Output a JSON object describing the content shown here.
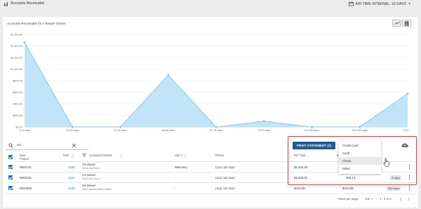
{
  "topbar": {
    "title": "Accounts Receivable",
    "interval_label": "A/R TIME INTERVAL: 15 DAYS"
  },
  "chart_data": {
    "type": "area",
    "title": "Accounts Receivable for 4 Repair Orders",
    "categories": [
      "0-15 days",
      "16-30 days",
      "31-45 days",
      "46-60 days",
      "61-75 days",
      "76-90 days",
      "91-105 days",
      "106-120 days",
      "120+"
    ],
    "values": [
      1460,
      0,
      0,
      895,
      0,
      100,
      0,
      0,
      575
    ],
    "yticks": [
      "$0.00",
      "$200.00",
      "$400.00",
      "$600.00",
      "$800.00",
      "$1,000.00",
      "$1,200.00",
      "$1,400.00",
      "$1,600.00"
    ],
    "ylim": [
      0,
      1600
    ],
    "grid": true,
    "color": "#6cbfef"
  },
  "search": {
    "value": "vin"
  },
  "print_button": {
    "label": "PRINT STATEMENT (1)"
  },
  "dropdown": {
    "items": [
      "Credit Card",
      "Cash",
      "Check",
      "Other"
    ]
  },
  "table": {
    "headers": {
      "date": "Date Posted",
      "ro": "RO#",
      "customer": "Customer/Vehicle",
      "unit": "Unit #",
      "phone": "Phone",
      "total": "RO Total",
      "balance": "B"
    },
    "rows": [
      {
        "date": "06/07/21",
        "ro": "1180",
        "name": "Vin Diesel",
        "vehicle": "2016 Kia Soul +",
        "unit": "Warranty",
        "phone": "(111) 111-1111",
        "total": "$1,622.60",
        "balance": "",
        "days": ""
      },
      {
        "date": "06/01/21",
        "ro": "1115",
        "name": "Vin Diesel",
        "vehicle": "2016 Kia Soul +",
        "unit": "-",
        "phone": "(111) 111-1111",
        "total": "$1,529.81",
        "balance": "$49.13",
        "days": "5 days"
      },
      {
        "date": "05/23/20",
        "ro": "1129",
        "name": "Vin Diesel",
        "vehicle": "2011 Nissan Altima Base",
        "unit": "-",
        "phone": "(111) 111-1111",
        "total": "$416.85",
        "balance": "$416.85",
        "days": "380 days"
      }
    ]
  },
  "footer": {
    "rows_per_page_label": "Rows per page",
    "rows_per_page_value": "100",
    "range": "1 - 3 of 3"
  }
}
